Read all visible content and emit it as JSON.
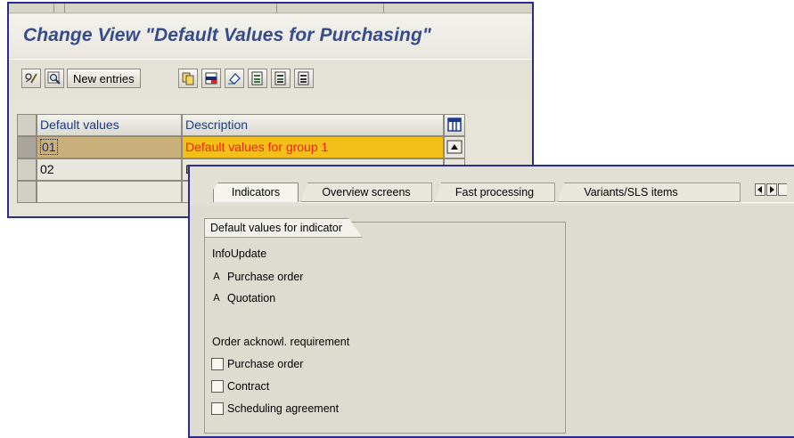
{
  "main_window": {
    "title": "Change View \"Default Values for Purchasing\"",
    "toolbar": {
      "new_entries_label": "New entries"
    },
    "table": {
      "columns": [
        "Default values",
        "Description"
      ],
      "rows": [
        {
          "default_value": "01",
          "description": "Default values for group 1"
        },
        {
          "default_value": "02",
          "description": "D"
        }
      ]
    }
  },
  "detail_window": {
    "tabs": [
      "Indicators",
      "Overview screens",
      "Fast processing",
      "Variants/SLS items"
    ],
    "group_title": "Default values for indicator",
    "info_update": {
      "label": "InfoUpdate",
      "items": [
        {
          "marker": "A",
          "label": "Purchase order"
        },
        {
          "marker": "A",
          "label": "Quotation"
        }
      ]
    },
    "order_ack": {
      "label": "Order acknowl. requirement",
      "items": [
        {
          "label": "Purchase order"
        },
        {
          "label": "Contract"
        },
        {
          "label": "Scheduling agreement"
        }
      ]
    }
  }
}
